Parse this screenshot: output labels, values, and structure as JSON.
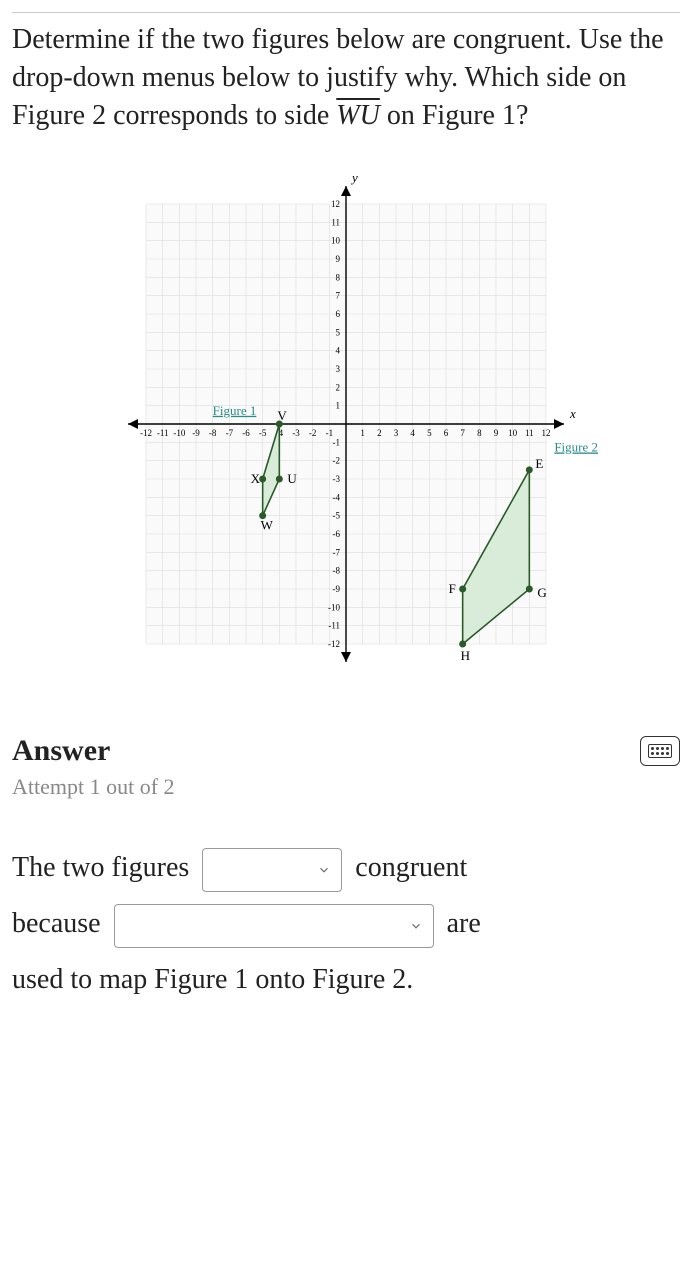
{
  "question": {
    "pre": "Determine if the two figures below are congruent. Use the drop-down menus below to justify why. Which side on Figure 2 corresponds to side ",
    "seg": "WU",
    "post": " on Figure 1?"
  },
  "answer": {
    "title": "Answer",
    "attempt": "Attempt 1 out of 2",
    "sentence": {
      "p1": "The two figures",
      "p2": "congruent",
      "p3": "because",
      "p4": "are",
      "p5": "used to map Figure 1 onto Figure 2."
    }
  },
  "chart_data": {
    "type": "scatter",
    "xlabel": "x",
    "ylabel": "y",
    "xlim": [
      -12,
      12
    ],
    "ylim": [
      -12,
      12
    ],
    "xticks": [
      -12,
      -11,
      -10,
      -9,
      -8,
      -7,
      -6,
      -5,
      -4,
      -3,
      -2,
      -1,
      1,
      2,
      3,
      4,
      5,
      6,
      7,
      8,
      9,
      10,
      11,
      12
    ],
    "yticks": [
      -12,
      -11,
      -10,
      -9,
      -8,
      -7,
      -6,
      -5,
      -4,
      -3,
      -2,
      -1,
      1,
      2,
      3,
      4,
      5,
      6,
      7,
      8,
      9,
      10,
      11,
      12
    ],
    "series": [
      {
        "name": "Figure 1",
        "label_pos": [
          -8,
          0.5
        ],
        "fill": "#d9ecd9",
        "points": [
          {
            "label": "V",
            "x": -4,
            "y": 0
          },
          {
            "label": "U",
            "x": -4,
            "y": -3
          },
          {
            "label": "W",
            "x": -5,
            "y": -5
          },
          {
            "label": "X",
            "x": -5,
            "y": -3
          }
        ]
      },
      {
        "name": "Figure 2",
        "label_pos": [
          12.5,
          -1.5
        ],
        "fill": "#d9ecd9",
        "points": [
          {
            "label": "E",
            "x": 11,
            "y": -2.5
          },
          {
            "label": "G",
            "x": 11,
            "y": -9
          },
          {
            "label": "H",
            "x": 7,
            "y": -12
          },
          {
            "label": "F",
            "x": 7,
            "y": -9
          }
        ]
      }
    ]
  }
}
